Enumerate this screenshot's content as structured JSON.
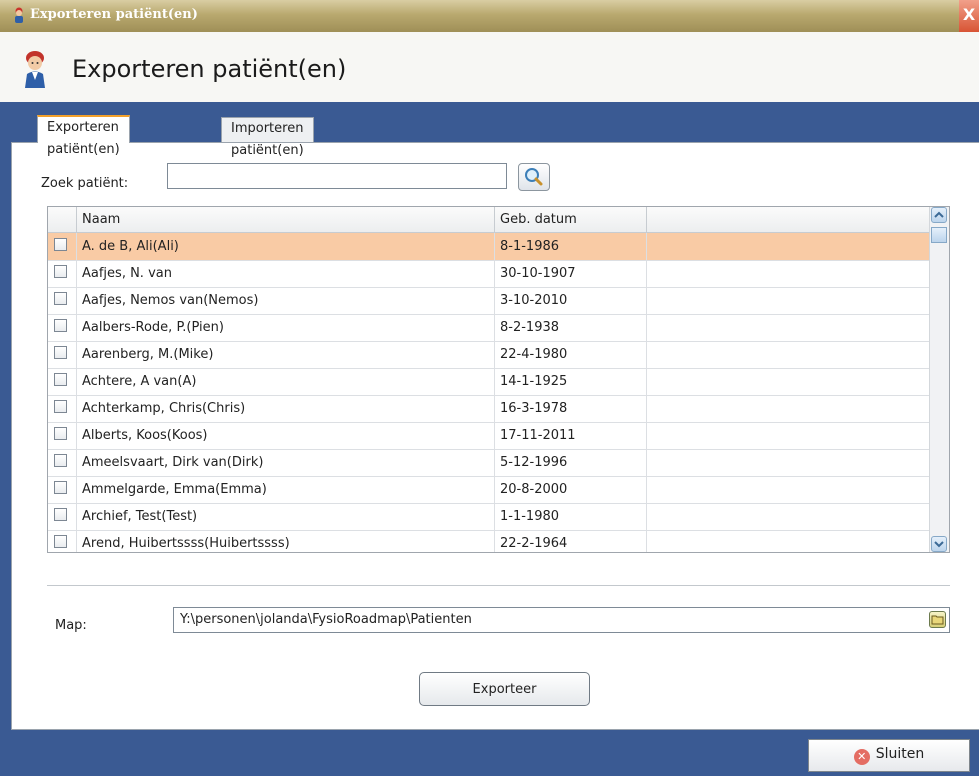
{
  "window": {
    "title": "Exporteren patiënt(en)",
    "close_glyph": "X",
    "title_icon": "doctor-icon"
  },
  "header": {
    "title": "Exporteren patiënt(en)",
    "icon": "doctor-avatar-icon"
  },
  "tabs": [
    {
      "label": "Exporteren patiënt(en)",
      "active": true
    },
    {
      "label": "Importeren patiënt(en)",
      "active": false
    }
  ],
  "search": {
    "label": "Zoek patiënt:",
    "value": "",
    "icon": "magnifier-icon"
  },
  "table": {
    "columns": [
      "Naam",
      "Geb. datum",
      ""
    ],
    "rows": [
      {
        "naam": "A. de B, Ali(Ali)",
        "datum": "8-1-1986",
        "selected": true
      },
      {
        "naam": "Aafjes, N. van",
        "datum": "30-10-1907"
      },
      {
        "naam": "Aafjes, Nemos van(Nemos)",
        "datum": "3-10-2010"
      },
      {
        "naam": "Aalbers-Rode, P.(Pien)",
        "datum": "8-2-1938"
      },
      {
        "naam": "Aarenberg, M.(Mike)",
        "datum": "22-4-1980"
      },
      {
        "naam": "Achtere, A van(A)",
        "datum": "14-1-1925"
      },
      {
        "naam": "Achterkamp, Chris(Chris)",
        "datum": "16-3-1978"
      },
      {
        "naam": "Alberts, Koos(Koos)",
        "datum": "17-11-2011"
      },
      {
        "naam": "Ameelsvaart, Dirk van(Dirk)",
        "datum": "5-12-1996"
      },
      {
        "naam": "Ammelgarde, Emma(Emma)",
        "datum": "20-8-2000"
      },
      {
        "naam": "Archief, Test(Test)",
        "datum": "1-1-1980"
      },
      {
        "naam": "Arend, Huibertssss(Huibertssss)",
        "datum": "22-2-1964"
      }
    ]
  },
  "map": {
    "label": "Map:",
    "value": "Y:\\personen\\jolanda\\FysioRoadmap\\Patienten",
    "icon": "folder-icon"
  },
  "buttons": {
    "export": "Exporteer",
    "close": "Sluiten",
    "close_icon": "close-circle-icon"
  },
  "colors": {
    "titlebar": "#b9a96f",
    "selected_row": "#f9cba5",
    "tab_accent": "#f2a02a",
    "footer": "#3a5a93"
  }
}
